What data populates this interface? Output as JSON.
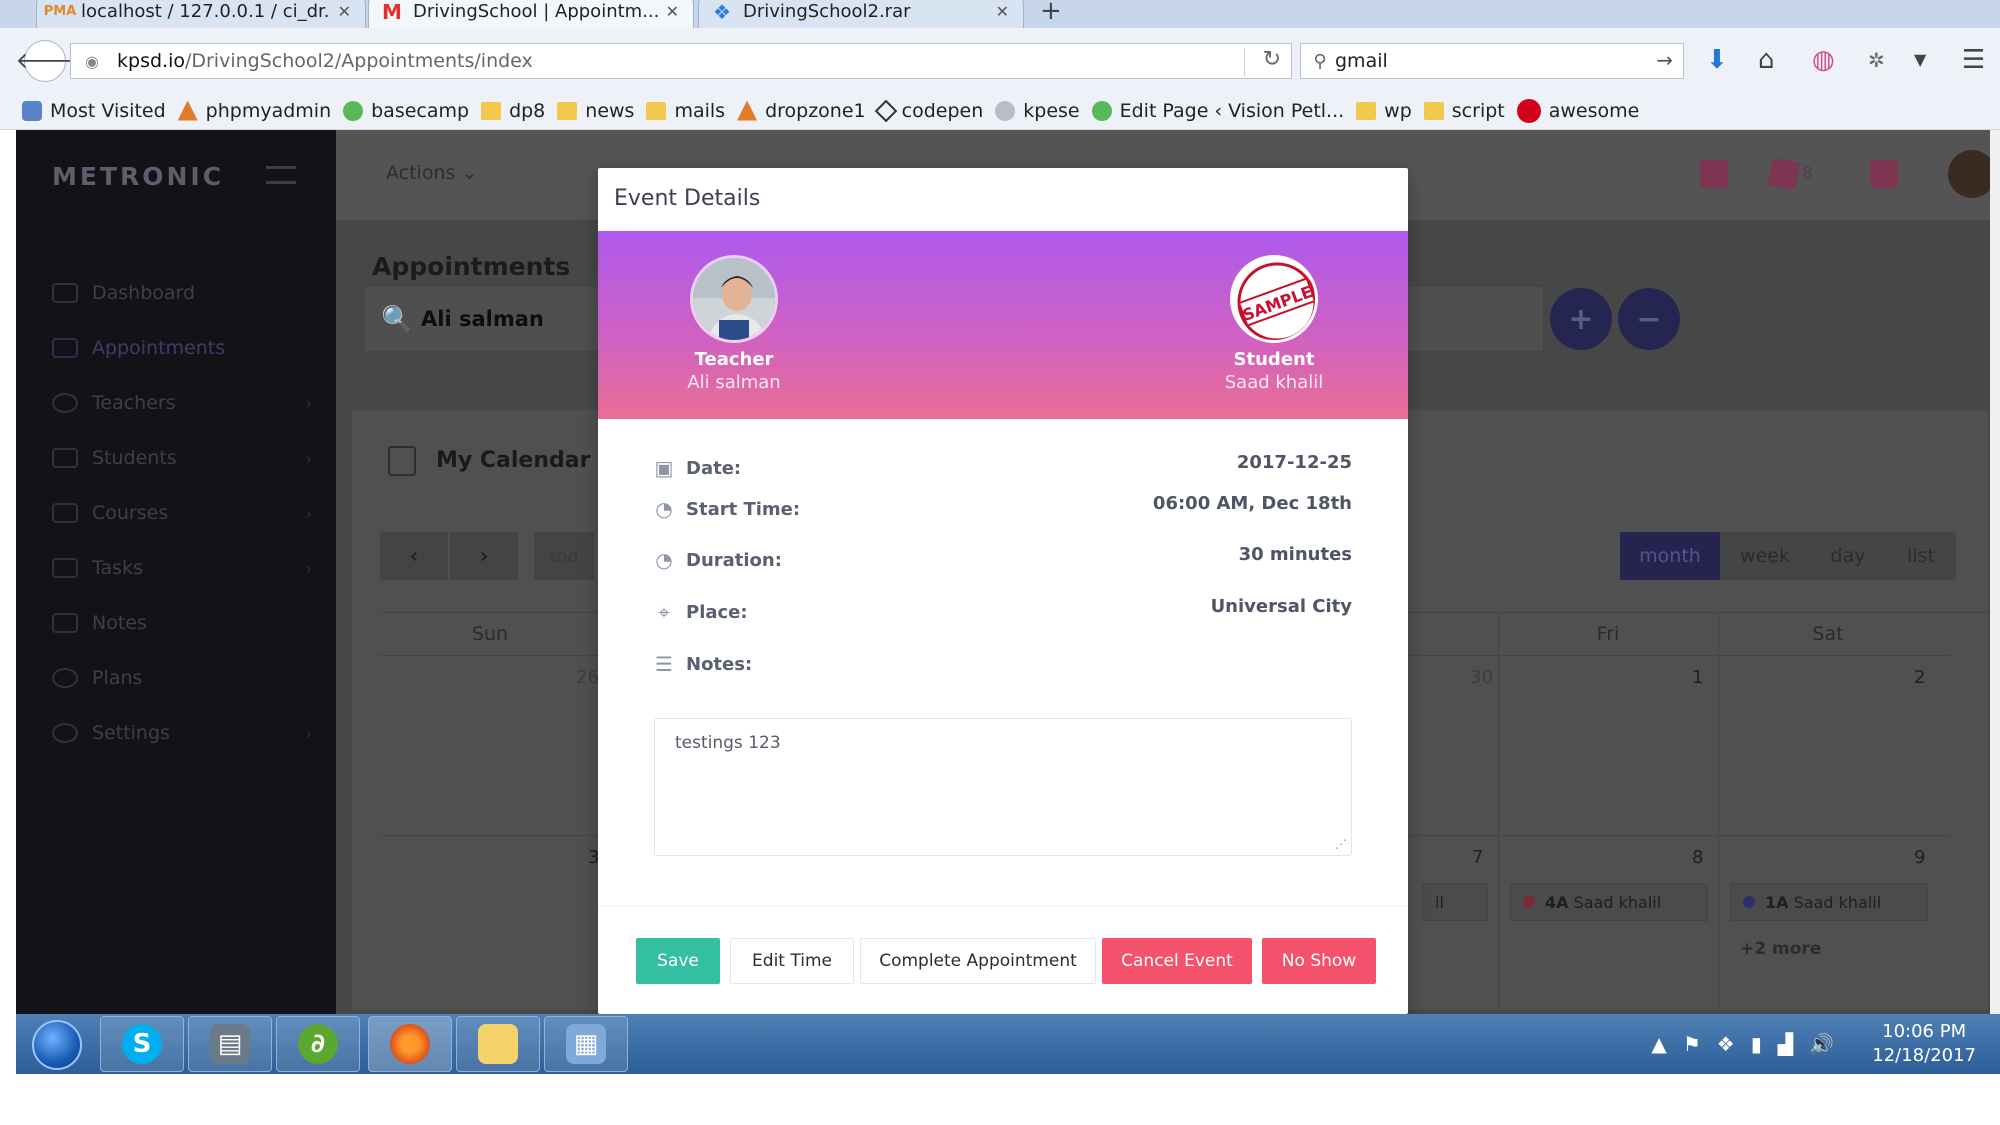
{
  "browser": {
    "tabs": [
      {
        "label": "localhost / 127.0.0.1 / ci_dr...",
        "favicon": "pma-icon"
      },
      {
        "label": "DrivingSchool | Appointm...",
        "favicon": "app-logo-icon"
      },
      {
        "label": "DrivingSchool2.rar",
        "favicon": "dropbox-icon"
      }
    ],
    "new_tab": "+",
    "url_host": "kpsd.io",
    "url_path": "/DrivingSchool2/Appointments/index",
    "search_value": "gmail",
    "bookmarks": [
      "Most Visited",
      "phpmyadmin",
      "basecamp",
      "dp8",
      "news",
      "mails",
      "dropzone1",
      "codepen",
      "kpese",
      "Edit Page ‹ Vision Petl...",
      "wp",
      "script",
      "awesome"
    ]
  },
  "app": {
    "brand": "METRONIC",
    "menu": [
      "Dashboard",
      "Appointments",
      "Teachers",
      "Students",
      "Courses",
      "Tasks",
      "Notes",
      "Plans",
      "Settings"
    ],
    "actions_label": "Actions",
    "notif_count": "8",
    "page_title": "Appointments",
    "search_value": "Ali salman",
    "plus_label": "+",
    "minus_label": "−",
    "calendar_title": "My Calendar",
    "today_label": "tod",
    "views": [
      "month",
      "week",
      "day",
      "list"
    ],
    "active_view": "month",
    "weekdays": [
      "Sun",
      "Fri",
      "Sat"
    ],
    "dates": {
      "d26": "26",
      "d30": "30",
      "d1": "1",
      "d2": "2",
      "d3": "3",
      "d7": "7",
      "d8": "8",
      "d9": "9"
    },
    "events": [
      {
        "code": "4A",
        "name": "Saad khalil",
        "color": "#f4516c"
      },
      {
        "code": "1A",
        "name": "Saad khalil",
        "color": "#5867dd"
      }
    ],
    "partial_event": "il",
    "more_label": "+2 more"
  },
  "modal": {
    "title": "Event Details",
    "teacher_role": "Teacher",
    "teacher_name": "Ali salman",
    "student_role": "Student",
    "student_name": "Saad khalil",
    "student_badge": "SAMPLE",
    "date_label": "Date:",
    "date_value": "2017-12-25",
    "start_label": "Start Time:",
    "start_value": "06:00 AM, Dec 18th",
    "duration_label": "Duration:",
    "duration_value": "30 minutes",
    "place_label": "Place:",
    "place_value": "Universal City",
    "notes_label": "Notes:",
    "notes_value": "testings 123",
    "buttons": {
      "save": "Save",
      "edit_time": "Edit Time",
      "complete": "Complete Appointment",
      "cancel": "Cancel Event",
      "no_show": "No Show"
    },
    "colors": {
      "save": "#34bfa3",
      "danger": "#f4516c",
      "gradient_top": "#ad59ed",
      "gradient_bottom": "#e96f94"
    }
  },
  "taskbar": {
    "time": "10:06 PM",
    "date": "12/18/2017"
  }
}
